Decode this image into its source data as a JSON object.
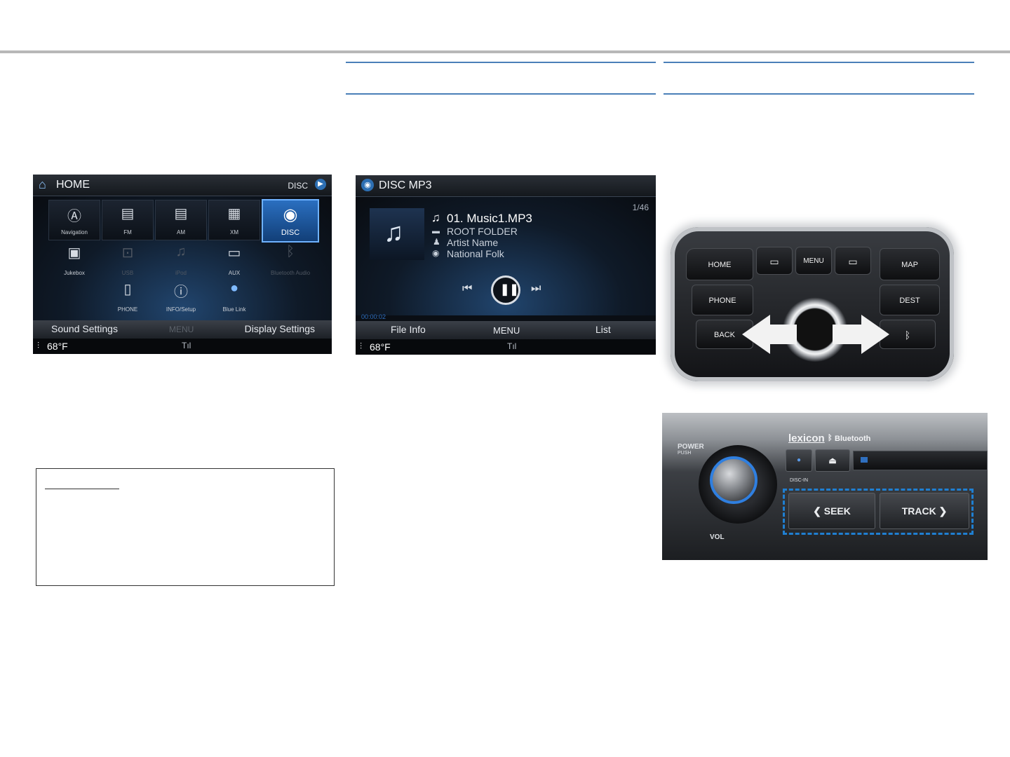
{
  "home_screen": {
    "title": "HOME",
    "source": "DISC",
    "grid_row1": [
      {
        "label": "Navigation",
        "icon": "navigation-icon"
      },
      {
        "label": "FM",
        "icon": "radio-icon"
      },
      {
        "label": "AM",
        "icon": "radio-icon"
      },
      {
        "label": "XM",
        "icon": "xm-radio-icon"
      },
      {
        "label": "DISC",
        "icon": "disc-icon"
      }
    ],
    "grid_row2": [
      {
        "label": "Jukebox",
        "icon": "jukebox-icon"
      },
      {
        "label": "USB",
        "icon": "usb-icon"
      },
      {
        "label": "iPod",
        "icon": "ipod-icon"
      },
      {
        "label": "AUX",
        "icon": "aux-icon"
      },
      {
        "label": "Bluetooth Audio",
        "icon": "bluetooth-audio-icon"
      }
    ],
    "grid_row3": [
      {
        "label": "PHONE",
        "icon": "phone-icon"
      },
      {
        "label": "INFO/Setup",
        "icon": "info-icon"
      },
      {
        "label": "Blue Link",
        "icon": "blue-link-icon"
      }
    ],
    "softkeys": {
      "left": "Sound Settings",
      "center": "MENU",
      "right": "Display Settings"
    },
    "temperature": "68°F"
  },
  "disc_screen": {
    "title": "DISC MP3",
    "track_count": "1/46",
    "track_name": "01. Music1.MP3",
    "folder": "ROOT FOLDER",
    "artist": "Artist Name",
    "genre": "National Folk",
    "elapsed": "00:00:02",
    "softkeys": {
      "left": "File Info",
      "center": "MENU",
      "right": "List"
    },
    "temperature": "68°F"
  },
  "controller": {
    "home": "HOME",
    "menu": "MENU",
    "map": "MAP",
    "phone": "PHONE",
    "dest": "DEST",
    "back": "BACK"
  },
  "head_unit": {
    "brand": "lexicon",
    "bluetooth": "Bluetooth",
    "power_label": "POWER",
    "push_label": "PUSH",
    "vol_label": "VOL",
    "disc_in": "DISC-IN",
    "seek": "SEEK",
    "track": "TRACK",
    "highlight_color": "#1f7fd1"
  },
  "colors": {
    "rule_blue": "#4a7fb8",
    "rule_gray": "#b8b8b8"
  }
}
